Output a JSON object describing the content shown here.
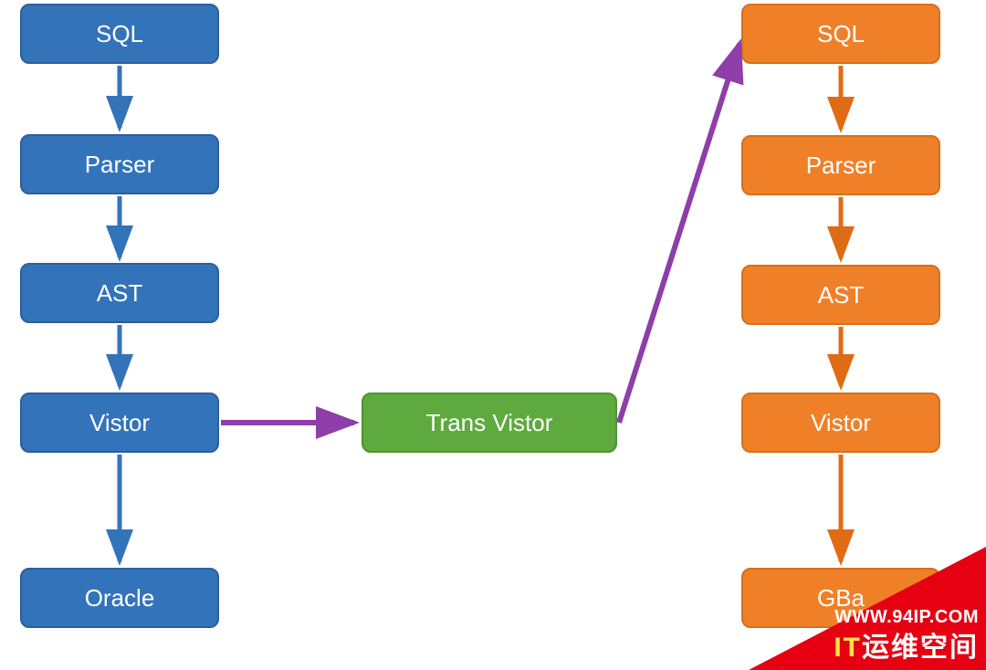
{
  "left": {
    "sql": "SQL",
    "parser": "Parser",
    "ast": "AST",
    "vistor": "Vistor",
    "oracle": "Oracle"
  },
  "middle": {
    "trans": "Trans Vistor"
  },
  "right": {
    "sql": "SQL",
    "parser": "Parser",
    "ast": "AST",
    "vistor": "Vistor",
    "gbase": "GBa"
  },
  "colors": {
    "blue": "#3373ba",
    "orange": "#f08028",
    "green": "#5eaa3e",
    "purple": "#8e3ea8",
    "red": "#e60012"
  },
  "watermark": {
    "url": "WWW.94IP.COM",
    "brand_prefix": "IT",
    "brand_suffix": "运维空间"
  }
}
